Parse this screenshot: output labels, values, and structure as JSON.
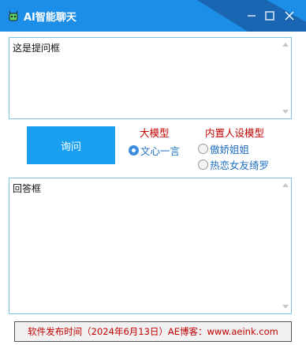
{
  "window": {
    "title": "AI智能聊天",
    "icon": "android-robot-icon",
    "accent": "#1c8ee8"
  },
  "question_box": {
    "value": "这是提问框"
  },
  "ask_button": {
    "label": "询问",
    "color": "#1aa0f0"
  },
  "model_group": {
    "title": "大模型",
    "options": [
      {
        "label": "文心一言",
        "selected": true
      }
    ]
  },
  "persona_group": {
    "title": "内置人设模型",
    "options": [
      {
        "label": "傲娇姐姐",
        "selected": false
      },
      {
        "label": "热恋女友绮罗",
        "selected": false
      }
    ]
  },
  "answer_box": {
    "value": "回答框"
  },
  "footer": {
    "text": "软件发布时间（2024年6月13日）AE博客：www.aeink.com",
    "color": "#c00000"
  }
}
